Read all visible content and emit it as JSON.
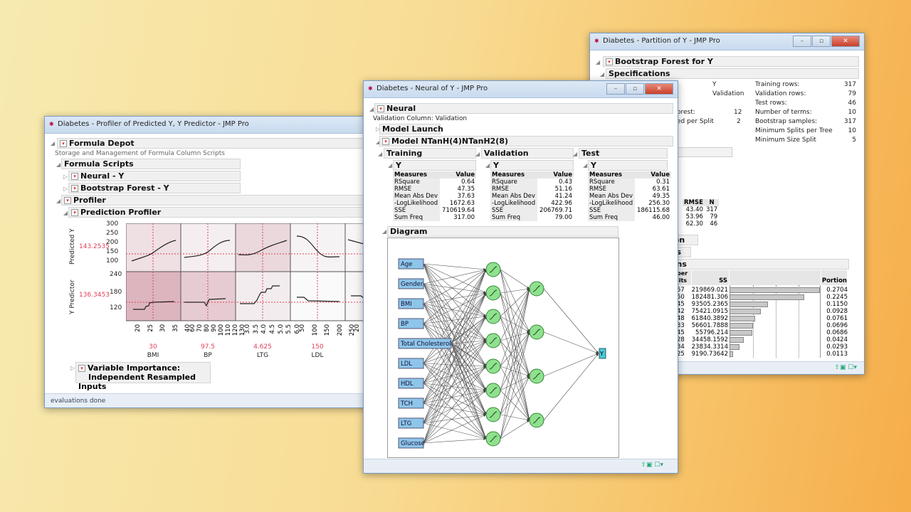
{
  "partition_window": {
    "title": "Diabetes - Partition of Y - JMP Pro",
    "header": "Bootstrap Forest for Y",
    "specifications": "Specifications",
    "spec_left": [
      {
        "value": "Y"
      },
      {
        "value": "Validation"
      },
      {
        "label": "orest:",
        "value": "12"
      },
      {
        "label": "ed per Split",
        "value": "2"
      }
    ],
    "spec_right": [
      {
        "label": "Training rows:",
        "value": "317"
      },
      {
        "label": "Validation rows:",
        "value": "79"
      },
      {
        "label": "Test rows:",
        "value": "46"
      },
      {
        "label": "Number of terms:",
        "value": "10"
      },
      {
        "label": "Bootstrap samples:",
        "value": "317"
      },
      {
        "label": "Minimum Splits per Tree",
        "value": "10"
      },
      {
        "label": "Minimum Size Split",
        "value": "5"
      }
    ],
    "fit_headers": [
      "RMSE",
      "N"
    ],
    "fit_rows": [
      [
        "43.40",
        "317"
      ],
      [
        "53.96",
        "79"
      ],
      [
        "62.30",
        "46"
      ]
    ],
    "partial_headers": [
      "ion",
      "es",
      "ons"
    ],
    "contrib_headers": {
      "splits": "ber\nlits",
      "ss": "SS",
      "portion": "Portion"
    },
    "contrib_rows": [
      {
        "splits": "57",
        "ss": "219869.021",
        "portion": 0.2704
      },
      {
        "splits": "50",
        "ss": "182481.306",
        "portion": 0.2245
      },
      {
        "splits": "45",
        "ss": "93505.2365",
        "portion": 0.115
      },
      {
        "splits": "42",
        "ss": "75421.0915",
        "portion": 0.0928
      },
      {
        "splits": "48",
        "ss": "61840.3892",
        "portion": 0.0761
      },
      {
        "splits": "33",
        "ss": "56601.7888",
        "portion": 0.0696
      },
      {
        "splits": "45",
        "ss": "55796.214",
        "portion": 0.0686
      },
      {
        "splits": "28",
        "ss": "34458.1592",
        "portion": 0.0424
      },
      {
        "splits": "34",
        "ss": "23834.3314",
        "portion": 0.0293
      },
      {
        "splits": "25",
        "ss": "9190.73642",
        "portion": 0.0113
      }
    ]
  },
  "neural_window": {
    "title": "Diabetes - Neural of Y - JMP Pro",
    "header": "Neural",
    "validation_column": "Validation Column: Validation",
    "model_launch": "Model Launch",
    "model": "Model NTanH(4)NTanH2(8)",
    "sets": [
      {
        "name": "Training",
        "y": "Y",
        "values": [
          "0.64",
          "47.35",
          "37.63",
          "1672.63",
          "710619.64",
          "317.00"
        ]
      },
      {
        "name": "Validation",
        "y": "Y",
        "values": [
          "0.43",
          "51.16",
          "41.24",
          "422.96",
          "206769.71",
          "79.00"
        ]
      },
      {
        "name": "Test",
        "y": "Y",
        "values": [
          "0.31",
          "63.61",
          "49.35",
          "256.30",
          "186115.68",
          "46.00"
        ]
      }
    ],
    "measure_headers": [
      "Measures",
      "Value"
    ],
    "measures": [
      "RSquare",
      "RMSE",
      "Mean Abs Dev",
      "-LogLikelihood",
      "SSE",
      "Sum Freq"
    ],
    "diagram": "Diagram",
    "inputs": [
      "Age",
      "Gender",
      "BMI",
      "BP",
      "Total Cholesterol",
      "LDL",
      "HDL",
      "TCH",
      "LTG",
      "Glucose"
    ],
    "output": "Y"
  },
  "profiler_window": {
    "title": "Diabetes - Profiler of Predicted Y, Y Predictor - JMP Pro",
    "formula_depot": "Formula Depot",
    "subtitle": "Storage and Management of Formula Column Scripts",
    "formula_scripts": "Formula Scripts",
    "scripts": [
      "Neural - Y",
      "Bootstrap Forest - Y"
    ],
    "profiler": "Profiler",
    "prediction_profiler": "Prediction Profiler",
    "responses": [
      {
        "name": "Predicted Y",
        "current": "143.2535",
        "ticks": [
          "300",
          "250",
          "200",
          "150",
          "100"
        ]
      },
      {
        "name": "Y Predictor",
        "current": "136.3453",
        "ticks": [
          "240",
          "180",
          "120"
        ]
      }
    ],
    "factors": [
      {
        "name": "BMI",
        "current": "30",
        "ticks": [
          "20",
          "25",
          "30",
          "35",
          "40"
        ]
      },
      {
        "name": "BP",
        "current": "97.5",
        "ticks": [
          "60",
          "70",
          "80",
          "90",
          "100",
          "110",
          "120",
          "130"
        ]
      },
      {
        "name": "LTG",
        "current": "4.625",
        "ticks": [
          "3.0",
          "3.5",
          "4.0",
          "4.5",
          "5.0",
          "5.5",
          "6.0"
        ]
      },
      {
        "name": "LDL",
        "current": "150",
        "ticks": [
          "50",
          "100",
          "150",
          "200",
          "250"
        ]
      },
      {
        "name": "",
        "current": "",
        "ticks": [
          "20",
          "30",
          "40"
        ]
      }
    ],
    "variable_importance": [
      "Variable Importance:",
      "Independent Resampled Inputs"
    ],
    "status": "evaluations done"
  },
  "colors": {
    "accent_red": "#e0405a",
    "node_green": "#8fe08f",
    "input_box": "#8ec5ea"
  }
}
